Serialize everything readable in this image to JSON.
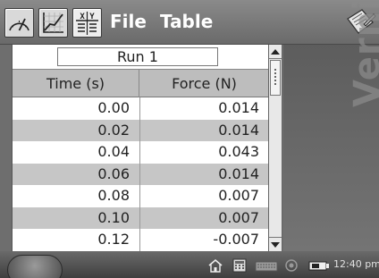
{
  "toolbar": {
    "menu": [
      {
        "label": "File"
      },
      {
        "label": "Table"
      }
    ],
    "icons": [
      "meter-view-icon",
      "graph-view-icon",
      "table-view-icon",
      "notes-icon"
    ],
    "table_icon_text": {
      "top": "X Y"
    }
  },
  "table": {
    "run_label": "Run 1",
    "columns": [
      "Time (s)",
      "Force (N)"
    ],
    "rows": [
      [
        "0.00",
        "0.014"
      ],
      [
        "0.02",
        "0.014"
      ],
      [
        "0.04",
        "0.043"
      ],
      [
        "0.06",
        "0.014"
      ],
      [
        "0.08",
        "0.007"
      ],
      [
        "0.10",
        "0.007"
      ],
      [
        "0.12",
        "-0.007"
      ]
    ]
  },
  "background": {
    "watermark": "Vernier"
  },
  "statusbar": {
    "icons": [
      "home-icon",
      "calculator-icon",
      "keyboard-icon",
      "speaker-icon",
      "battery-icon"
    ],
    "clock": "12:40 pm"
  },
  "colors": {
    "row_alt": "#c6c6c6",
    "header_bg": "#bdbdbd",
    "titlebar": "#7a7a7a"
  }
}
